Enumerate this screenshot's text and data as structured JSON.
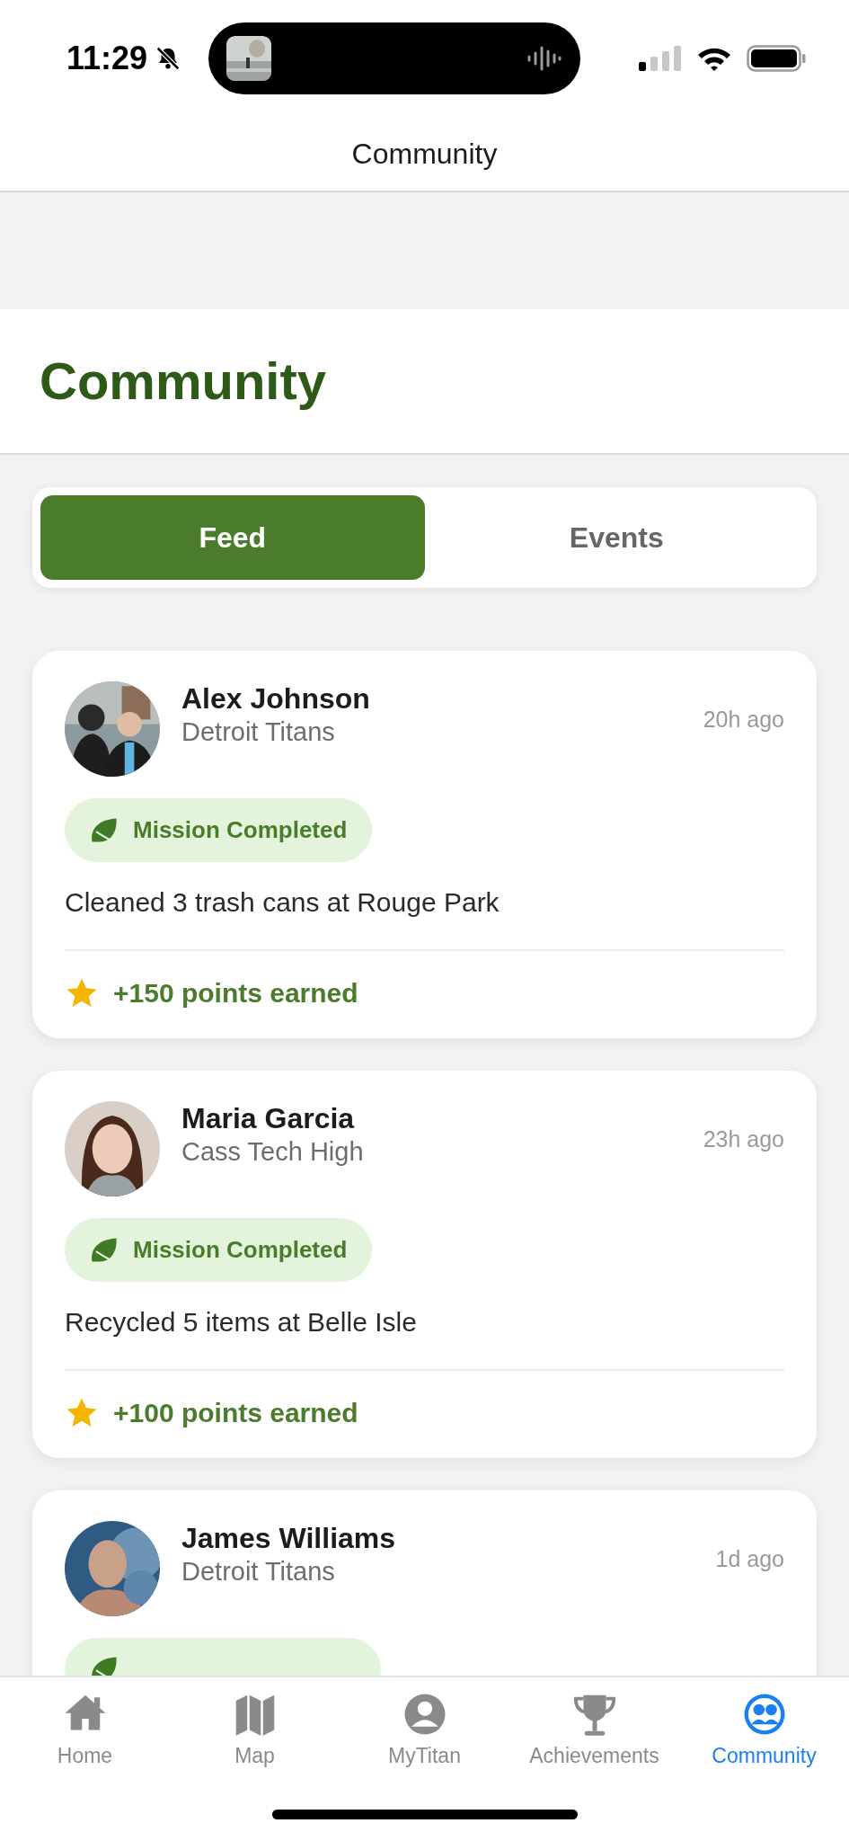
{
  "status_bar": {
    "time": "11:29"
  },
  "nav_bar": {
    "title": "Community"
  },
  "header": {
    "title": "Community"
  },
  "segments": [
    {
      "label": "Feed",
      "selected": true
    },
    {
      "label": "Events",
      "selected": false
    }
  ],
  "feed": [
    {
      "name": "Alex Johnson",
      "team": "Detroit Titans",
      "time": "20h ago",
      "badge": "Mission Completed",
      "text": "Cleaned 3 trash cans at Rouge Park",
      "points": "+150 points earned"
    },
    {
      "name": "Maria Garcia",
      "team": "Cass Tech High",
      "time": "23h ago",
      "badge": "Mission Completed",
      "text": "Recycled 5 items at Belle Isle",
      "points": "+100 points earned"
    },
    {
      "name": "James Williams",
      "team": "Detroit Titans",
      "time": "1d ago"
    }
  ],
  "tab_bar": [
    {
      "label": "Home",
      "selected": false
    },
    {
      "label": "Map",
      "selected": false
    },
    {
      "label": "MyTitan",
      "selected": false
    },
    {
      "label": "Achievements",
      "selected": false
    },
    {
      "label": "Community",
      "selected": true
    }
  ]
}
